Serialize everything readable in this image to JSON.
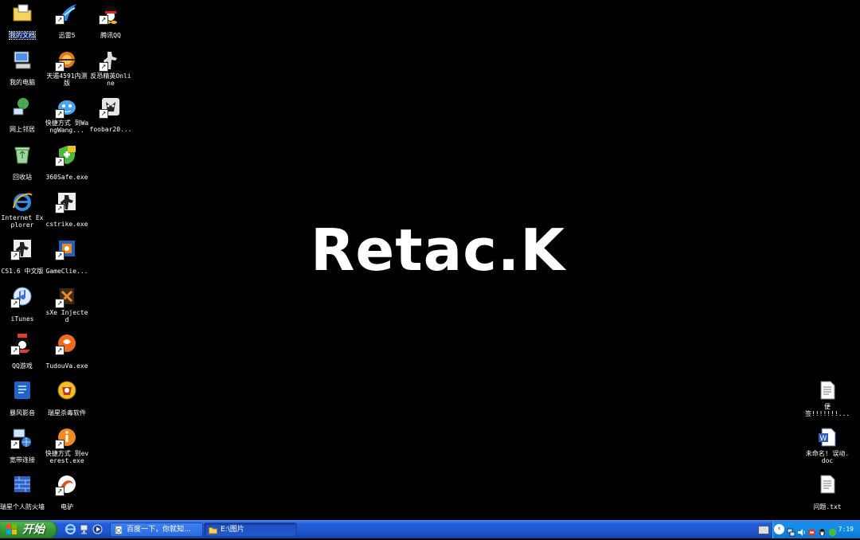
{
  "desktop": {
    "watermark": "Retac.K",
    "icons_left": [
      {
        "label": "我的文档",
        "icon": "my-documents-icon",
        "shortcut": false,
        "selected": true
      },
      {
        "label": "迅雷5",
        "icon": "xunlei-icon",
        "shortcut": true
      },
      {
        "label": "腾讯QQ",
        "icon": "qq-penguin-icon",
        "shortcut": true
      },
      {
        "label": "我的电脑",
        "icon": "my-computer-icon",
        "shortcut": false
      },
      {
        "label": "天遁4591内测版",
        "icon": "tiandun-icon",
        "shortcut": true
      },
      {
        "label": "反恐精英Online",
        "icon": "cs-online-icon",
        "shortcut": true
      },
      {
        "label": "网上邻居",
        "icon": "network-places-icon",
        "shortcut": false
      },
      {
        "label": "快捷方式 到WangWang...",
        "icon": "wangwang-icon",
        "shortcut": true
      },
      {
        "label": "foobar20...",
        "icon": "foobar-icon",
        "shortcut": true
      },
      {
        "label": "回收站",
        "icon": "recycle-bin-icon",
        "shortcut": false
      },
      {
        "label": "360Safe.exe",
        "icon": "360safe-icon",
        "shortcut": true
      },
      {
        "label": "Internet Explorer",
        "icon": "internet-explorer-icon",
        "shortcut": false
      },
      {
        "label": "cstrike.exe",
        "icon": "cstrike-icon",
        "shortcut": true
      },
      {
        "label": "CS1.6 中文版",
        "icon": "cs16-icon",
        "shortcut": true
      },
      {
        "label": "GameClie...",
        "icon": "gameclient-icon",
        "shortcut": true
      },
      {
        "label": "iTunes",
        "icon": "itunes-icon",
        "shortcut": true
      },
      {
        "label": "sXe Injected",
        "icon": "sxe-icon",
        "shortcut": true
      },
      {
        "label": "QQ游戏",
        "icon": "qq-game-icon",
        "shortcut": true
      },
      {
        "label": "TudouVa.exe",
        "icon": "tudou-icon",
        "shortcut": true
      },
      {
        "label": "暴风影音",
        "icon": "baofeng-icon",
        "shortcut": false
      },
      {
        "label": "瑞星杀毒软件",
        "icon": "rising-antivirus-icon",
        "shortcut": false
      },
      {
        "label": "宽带连接",
        "icon": "broadband-icon",
        "shortcut": true
      },
      {
        "label": "快捷方式 到everest.exe",
        "icon": "everest-icon",
        "shortcut": true
      },
      {
        "label": "瑞星个人防火墙",
        "icon": "rising-firewall-icon",
        "shortcut": false
      },
      {
        "label": "电驴",
        "icon": "emule-icon",
        "shortcut": true
      }
    ],
    "icons_right": [
      {
        "label": "便签!!!!!!!...",
        "icon": "text-file-icon"
      },
      {
        "label": "未命名! 误动.doc",
        "icon": "word-doc-icon"
      },
      {
        "label": "问题.txt",
        "icon": "text-file-icon"
      }
    ]
  },
  "taskbar": {
    "start_label": "开始",
    "quick_launch": [
      "internet-explorer-icon",
      "show-desktop-icon",
      "media-player-icon"
    ],
    "tasks": [
      {
        "label": "百度一下，你就知...",
        "icon": "ie-page-icon",
        "active": false
      },
      {
        "label": "E:\\图片",
        "icon": "folder-icon",
        "active": true
      }
    ],
    "tray_icons": [
      "network-icon",
      "volume-icon",
      "antivirus-tray-icon",
      "qq-tray-icon",
      "security-shield-icon"
    ],
    "clock": "7:19"
  },
  "colors": {
    "taskbar_blue": "#245edb",
    "start_green": "#389a38",
    "tray_blue": "#138fe8",
    "desktop_bg": "#000000"
  }
}
